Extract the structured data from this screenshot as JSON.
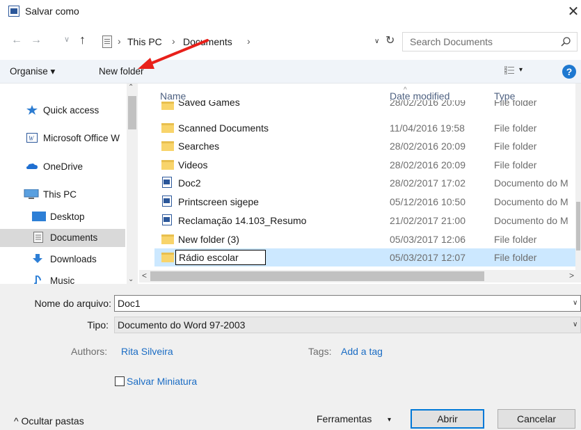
{
  "window": {
    "title": "Salvar como",
    "close_glyph": "✕"
  },
  "navigation": {
    "back_glyph": "←",
    "forward_glyph": "→",
    "recent_glyph": "∨",
    "up_glyph": "↑",
    "breadcrumb": [
      "This PC",
      "Documents"
    ],
    "separator": "›",
    "dropdown_glyph": "∨",
    "refresh_glyph": "↻",
    "search_placeholder": "Search Documents"
  },
  "toolbar": {
    "organise_label": "Organise ▾",
    "new_folder_label": "New folder",
    "views_dropdown": "▾",
    "help_label": "?"
  },
  "sidebar": {
    "items": [
      {
        "label": "Quick access",
        "icon": "star-icon"
      },
      {
        "label": "Microsoft Office W",
        "icon": "word-icon"
      },
      {
        "label": "OneDrive",
        "icon": "cloud-icon"
      },
      {
        "label": "This PC",
        "icon": "computer-icon"
      },
      {
        "label": "Desktop",
        "icon": "desktop-icon"
      },
      {
        "label": "Documents",
        "icon": "documents-icon",
        "selected": true
      },
      {
        "label": "Downloads",
        "icon": "download-icon"
      },
      {
        "label": "Music",
        "icon": "music-icon"
      }
    ],
    "scroll_up": "⌃",
    "scroll_down": "⌄"
  },
  "filelist": {
    "columns": [
      "Name",
      "Date modified",
      "Type"
    ],
    "sort_glyph": "^",
    "rows": [
      {
        "name": "Saved Games",
        "date": "28/02/2016 20:09",
        "type": "File folder",
        "kind": "folder"
      },
      {
        "name": "Scanned Documents",
        "date": "11/04/2016 19:58",
        "type": "File folder",
        "kind": "folder"
      },
      {
        "name": "Searches",
        "date": "28/02/2016 20:09",
        "type": "File folder",
        "kind": "folder"
      },
      {
        "name": "Videos",
        "date": "28/02/2016 20:09",
        "type": "File folder",
        "kind": "folder"
      },
      {
        "name": "Doc2",
        "date": "28/02/2017 17:02",
        "type": "Documento do M",
        "kind": "doc"
      },
      {
        "name": "Printscreen sigepe",
        "date": "05/12/2016 10:50",
        "type": "Documento do M",
        "kind": "doc"
      },
      {
        "name": "Reclamação 14.103_Resumo",
        "date": "21/02/2017 21:00",
        "type": "Documento do M",
        "kind": "doc"
      },
      {
        "name": "New folder (3)",
        "date": "05/03/2017 12:06",
        "type": "File folder",
        "kind": "folder"
      },
      {
        "name": "Rádio escolar",
        "date": "05/03/2017 12:07",
        "type": "File folder",
        "kind": "folder",
        "editing": true
      }
    ],
    "h_left": "<",
    "h_right": ">"
  },
  "form": {
    "filename_label": "Nome do arquivo:",
    "filename_value": "Doc1",
    "type_label": "Tipo:",
    "type_value": "Documento do Word 97-2003",
    "dropdown_glyph": "∨",
    "authors_label": "Authors:",
    "authors_value": "Rita Silveira",
    "tags_label": "Tags:",
    "tags_value": "Add a tag",
    "thumbnail_label": "Salvar Miniatura"
  },
  "footer": {
    "hide_folders_label": "^  Ocultar pastas",
    "tools_label": "Ferramentas",
    "tools_dropdown": "▾",
    "open_label": "Abrir",
    "cancel_label": "Cancelar"
  },
  "colors": {
    "accent": "#0078d7",
    "annotation_arrow": "#e8201a",
    "selected_row": "#cce8ff",
    "link": "#1a6cc4"
  }
}
